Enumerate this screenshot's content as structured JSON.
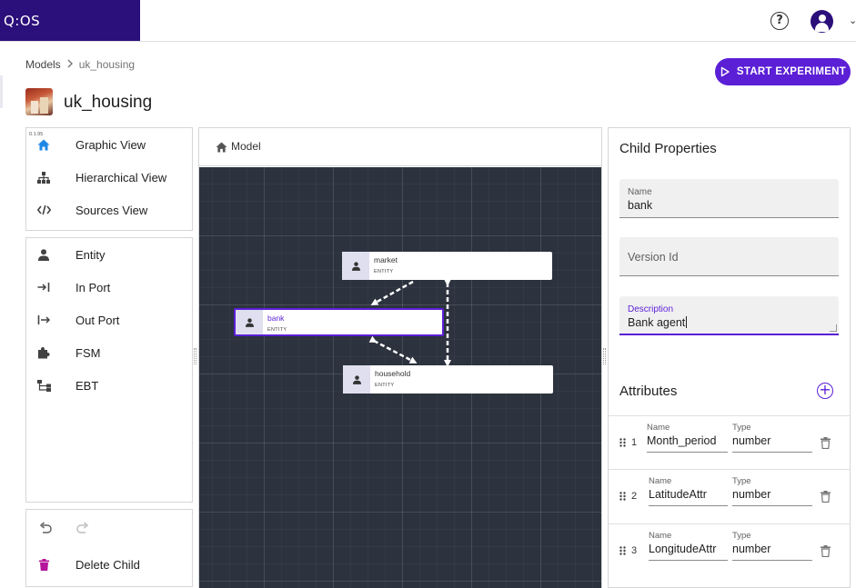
{
  "header": {
    "logo_text": "Q:OS",
    "help_glyph": "?",
    "user_menu_glyph": "⌄"
  },
  "breadcrumb": {
    "root": "Models",
    "current": "uk_housing"
  },
  "page": {
    "title": "uk_housing",
    "start_button_label": "START EXPERIMENT"
  },
  "views": {
    "version": "0.1.95",
    "items": [
      {
        "label": "Graphic View",
        "icon": "home-icon"
      },
      {
        "label": "Hierarchical View",
        "icon": "sitemap-icon"
      },
      {
        "label": "Sources View",
        "icon": "code-icon"
      }
    ]
  },
  "tools": {
    "items": [
      {
        "label": "Entity",
        "icon": "person-icon"
      },
      {
        "label": "In Port",
        "icon": "in-port-icon"
      },
      {
        "label": "Out Port",
        "icon": "out-port-icon"
      },
      {
        "label": "FSM",
        "icon": "puzzle-icon"
      },
      {
        "label": "EBT",
        "icon": "tree-icon"
      }
    ]
  },
  "actions": {
    "delete_label": "Delete Child",
    "delete_color": "#b5169a"
  },
  "canvas": {
    "breadcrumb_label": "Model",
    "nodes": [
      {
        "title": "market",
        "type": "ENTITY"
      },
      {
        "title": "bank",
        "type": "ENTITY",
        "selected": true
      },
      {
        "title": "household",
        "type": "ENTITY"
      }
    ]
  },
  "child_properties": {
    "title": "Child Properties",
    "name_label": "Name",
    "name_value": "bank",
    "version_placeholder": "Version Id",
    "description_label": "Description",
    "description_value": "Bank agent"
  },
  "attributes": {
    "title": "Attributes",
    "name_label": "Name",
    "type_label": "Type",
    "rows": [
      {
        "index": "1",
        "name": "Month_period",
        "type": "number"
      },
      {
        "index": "2",
        "name": "LatitudeAttr",
        "type": "number"
      },
      {
        "index": "3",
        "name": "LongitudeAttr",
        "type": "number"
      }
    ]
  },
  "colors": {
    "brand": "#2b0f7a",
    "accent": "#5b1fd6",
    "canvas_bg": "#2c333e"
  }
}
